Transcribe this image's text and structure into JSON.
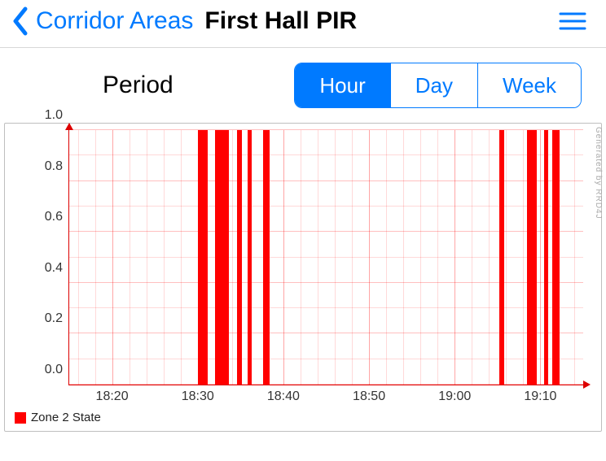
{
  "header": {
    "back_label": "Corridor Areas",
    "title": "First Hall PIR"
  },
  "controls": {
    "period_label": "Period",
    "segments": [
      "Hour",
      "Day",
      "Week"
    ],
    "active_segment": 0
  },
  "legend": {
    "label": "Zone 2 State",
    "color": "#ff0000"
  },
  "watermark": "Generated by RRD4J",
  "chart_data": {
    "type": "bar",
    "title": "",
    "xlabel": "",
    "ylabel": "",
    "ylim": [
      0,
      1.0
    ],
    "y_ticks": [
      0.0,
      0.2,
      0.4,
      0.6,
      0.8,
      1.0
    ],
    "x_range_minutes": [
      1095,
      1155
    ],
    "x_tick_minutes": [
      1100,
      1110,
      1120,
      1130,
      1140,
      1150
    ],
    "x_tick_labels": [
      "18:20",
      "18:30",
      "18:40",
      "18:50",
      "19:00",
      "19:10"
    ],
    "x_minor_step": 2,
    "series": [
      {
        "name": "Zone 2 State",
        "intervals": [
          {
            "start": 1110.0,
            "end": 1111.2,
            "value": 1.0
          },
          {
            "start": 1112.0,
            "end": 1113.6,
            "value": 1.0
          },
          {
            "start": 1114.6,
            "end": 1115.2,
            "value": 1.0
          },
          {
            "start": 1115.8,
            "end": 1116.3,
            "value": 1.0
          },
          {
            "start": 1117.6,
            "end": 1118.4,
            "value": 1.0
          },
          {
            "start": 1145.2,
            "end": 1145.8,
            "value": 1.0
          },
          {
            "start": 1148.4,
            "end": 1149.6,
            "value": 1.0
          },
          {
            "start": 1150.4,
            "end": 1150.9,
            "value": 1.0
          },
          {
            "start": 1151.4,
            "end": 1152.2,
            "value": 1.0
          }
        ]
      }
    ]
  }
}
